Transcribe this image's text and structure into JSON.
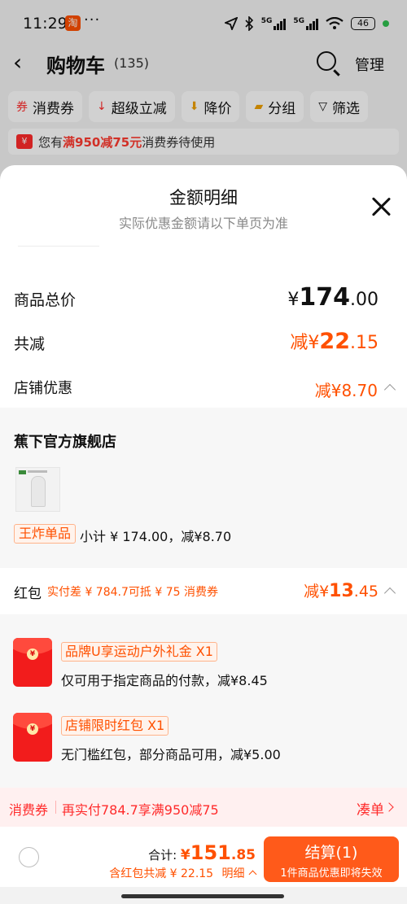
{
  "status_bar": {
    "time": "11:29",
    "app_badge": "淘",
    "more": "···",
    "network_left": "5G",
    "network_right": "5G",
    "battery": "46"
  },
  "nav": {
    "back_glyph": "‹",
    "title": "购物车",
    "count": "(135)",
    "manage": "管理"
  },
  "filters": [
    {
      "icon": "coupon-icon",
      "glyph": "券",
      "label": "消费券"
    },
    {
      "icon": "arrow-down-icon",
      "glyph": "↓",
      "label": "超级立减"
    },
    {
      "icon": "price-down-icon",
      "glyph": "⬇",
      "label": "降价"
    },
    {
      "icon": "folder-icon",
      "glyph": "▰",
      "label": "分组"
    },
    {
      "icon": "filter-icon",
      "glyph": "▽",
      "label": "筛选"
    }
  ],
  "notice": {
    "tag": "¥",
    "pre": "您有",
    "highlight": "满950减75元",
    "post": "消费券待使用"
  },
  "sheet": {
    "title": "金额明细",
    "subtitle": "实际优惠金额请以下单页为准",
    "total_label": "商品总价",
    "total_currency": "¥",
    "total_int": "174",
    "total_dec": ".00",
    "reduce_label": "共减",
    "reduce_prefix": "减¥",
    "reduce_int": "22",
    "reduce_dec": ".15",
    "shop_discount_label": "店铺优惠",
    "shop_discount_value": "减¥8.70",
    "store_name": "蕉下官方旗舰店",
    "product_badge": "王炸单品",
    "subtotal_text": "小计 ¥ 174.00，减¥8.70",
    "hongbao_label": "红包",
    "hongbao_note": "实付差 ¥ 784.7可抵 ¥ 75 消费券",
    "hongbao_prefix": "减¥",
    "hongbao_int": "13",
    "hongbao_dec": ".45",
    "red_packets": [
      {
        "tag": "品牌U享运动户外礼金 X1",
        "desc": "仅可用于指定商品的付款，减¥8.45"
      },
      {
        "tag": "店铺限时红包 X1",
        "desc": "无门槛红包，部分商品可用，减¥5.00"
      }
    ],
    "red_packet_seal": "¥"
  },
  "coupon_bar": {
    "label": "消费券",
    "text": "再实付784.7享满950减75",
    "action": "凑单"
  },
  "bottom": {
    "total_label": "合计: ",
    "total_currency": "¥",
    "total_int": "151",
    "total_dec": ".85",
    "sub_text": "含红包共减 ¥ 22.15",
    "detail_link": "明细",
    "checkout_label": "结算(1)",
    "checkout_note": "1件商品优惠即将失效"
  },
  "colors": {
    "accent": "#ff5000",
    "coupon_red": "#ff2b2b",
    "checkout_bg": "#ff5a1a"
  }
}
